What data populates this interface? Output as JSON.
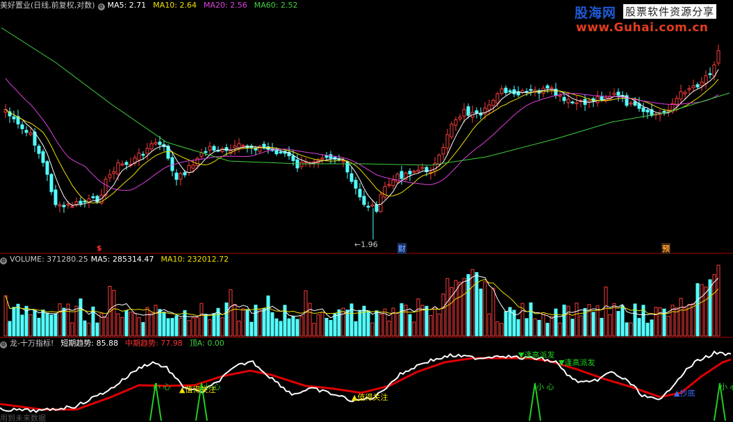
{
  "price_panel": {
    "title": "美好置业(日线,前复权,对数)",
    "ma": [
      {
        "label": "MA5: 2.71",
        "color": "#ffffff"
      },
      {
        "label": "MA10: 2.64",
        "color": "#f0e000"
      },
      {
        "label": "MA20: 2.56",
        "color": "#e040e0"
      },
      {
        "label": "MA60: 2.52",
        "color": "#40d040"
      }
    ],
    "low_marker": "←1.96",
    "event_marks": [
      {
        "label": "$",
        "color": "#ff3030"
      },
      {
        "label": "财",
        "color": "#5a8ff0"
      },
      {
        "label": "预",
        "color": "#ff9a30"
      }
    ],
    "colors": {
      "up": "#ff3c3c",
      "down": "#54ffff"
    }
  },
  "volume_panel": {
    "title": "VOLUME: 371280.25",
    "ma": [
      {
        "label": "MA5: 285314.47",
        "color": "#ffffff"
      },
      {
        "label": "MA10: 232012.72",
        "color": "#f0e000"
      }
    ]
  },
  "indicator_panel": {
    "title": "龙-十万指标!",
    "items": [
      {
        "label": "短期趋势: 85.88",
        "color": "#ffffff"
      },
      {
        "label": "中期趋势: 77.98",
        "color": "#ff3030"
      },
      {
        "label": "顶A: 0.00",
        "color": "#40d040"
      }
    ],
    "signals": {
      "careful": "小 心",
      "watch": "值得关注",
      "sell_high": "逢高派发",
      "bottom": "抄底"
    },
    "colors": {
      "short": "#ffffff",
      "mid": "#e00000",
      "top": "#20d020"
    }
  },
  "watermark": {
    "brand": "股海网",
    "tagline": "股票软件资源分享",
    "url": "www.Guhai.com.cn"
  },
  "footer": "用到未来数据"
}
